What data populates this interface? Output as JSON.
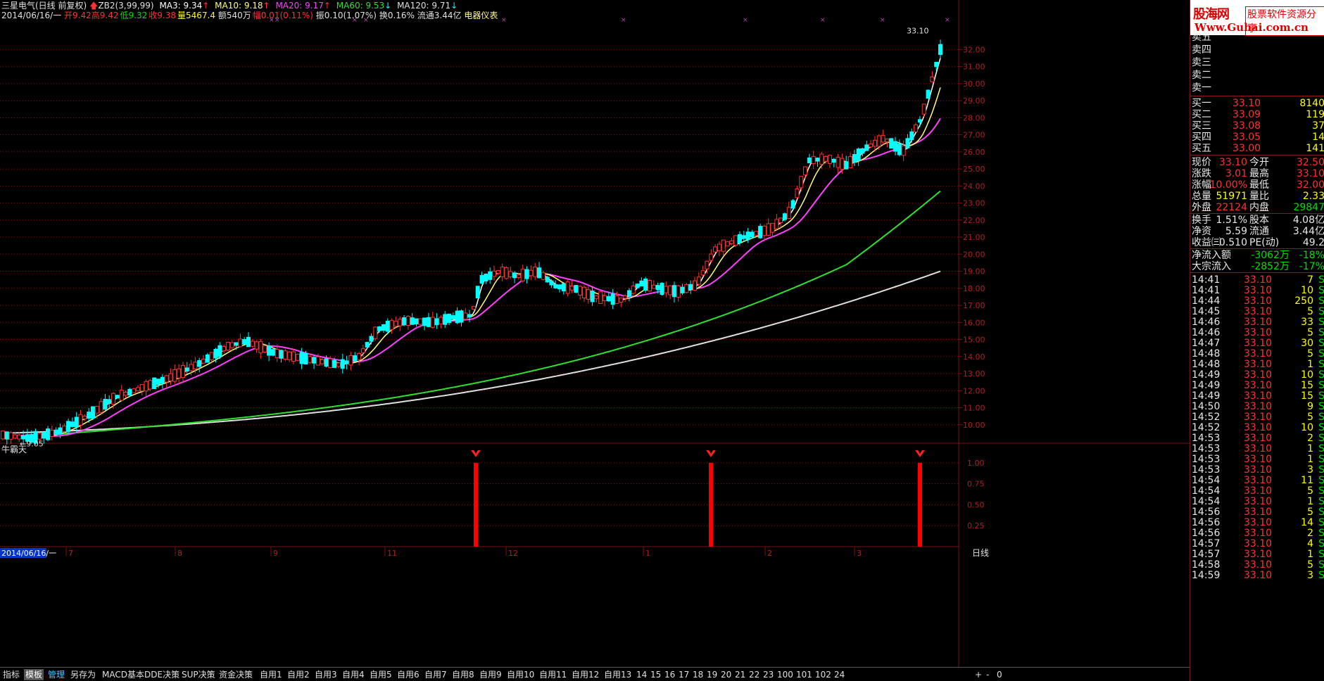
{
  "header": {
    "stock_name": "三星电气(日线 前复权)",
    "indicator": "ZB2(3,99,99)",
    "ma3": "MA3: 9.34",
    "ma10": "MA10: 9.18",
    "ma20": "MA20: 9.17",
    "ma60": "MA60: 9.53",
    "ma120": "MA120: 9.71",
    "date": "2014/06/16/一",
    "open": "开9.42",
    "high": "高9.42",
    "low": "低9.32",
    "close": "收9.38",
    "volume": "量5467.4",
    "amount": "额540万",
    "change": "幅0.01(0.11%)",
    "amplitude": "振0.10(1.07%)",
    "turnover": "换0.16%",
    "float": "流通3.44亿",
    "industry": "电器仪表"
  },
  "colors": {
    "up": "#ff3232",
    "down": "#00ffff",
    "ma3": "#ffffff",
    "ma10": "#ffff80",
    "ma20": "#ff40ff",
    "ma60": "#30e030",
    "ma120": "#e0e0e0",
    "grid": "#7a1010",
    "panel_border": "#8a1a1a"
  },
  "main_chart": {
    "y_ticks": [
      "10.00",
      "11.00",
      "12.00",
      "13.00",
      "14.00",
      "15.00",
      "16.00",
      "17.00",
      "18.00",
      "19.00",
      "20.00",
      "21.00",
      "22.00",
      "23.00",
      "24.00",
      "25.00",
      "26.00",
      "27.00",
      "28.00",
      "29.00",
      "30.00",
      "31.00",
      "32.00"
    ],
    "y_min": 9.0,
    "y_max": 33.5,
    "low_marker": "9.05",
    "high_marker": "33.10"
  },
  "sub_chart": {
    "title": "牛霸天",
    "y_ticks": [
      "1.00",
      "0.75",
      "0.50",
      "0.25"
    ],
    "signal_x": [
      676,
      1010,
      1307
    ],
    "signal_value": 1.0
  },
  "x_axis": {
    "date_label": "2014/06/16/一",
    "month_labels": [
      {
        "label": "7",
        "x": 97
      },
      {
        "label": "8",
        "x": 252
      },
      {
        "label": "9",
        "x": 388
      },
      {
        "label": "11",
        "x": 550
      },
      {
        "label": "12",
        "x": 722
      },
      {
        "label": "1",
        "x": 917
      },
      {
        "label": "2",
        "x": 1090
      },
      {
        "label": "3",
        "x": 1217
      }
    ],
    "period": "日线"
  },
  "bottom_tabs": [
    "指标",
    "模板",
    "管理",
    "另存为",
    "MACD基本",
    "DDE决策",
    "SUP决策",
    "资金决策",
    "自用1",
    "自用2",
    "自用3",
    "自用4",
    "自用5",
    "自用6",
    "自用7",
    "自用8",
    "自用9",
    "自用10",
    "自用11",
    "自用12",
    "自用13",
    "14",
    "15",
    "16",
    "17",
    "18",
    "19",
    "20",
    "21",
    "22",
    "23",
    "100",
    "101",
    "102",
    "24"
  ],
  "bottom_controls": [
    "+",
    "-",
    "0"
  ],
  "logo": {
    "name": "股海网",
    "slogan": "股票软件资源分享",
    "url": "Www.Guhai.com.cn"
  },
  "order_book": {
    "sells": [
      {
        "label": "卖五"
      },
      {
        "label": "卖四"
      },
      {
        "label": "卖三"
      },
      {
        "label": "卖二"
      },
      {
        "label": "卖一"
      }
    ],
    "buys": [
      {
        "label": "买一",
        "price": "33.10",
        "vol": "8140"
      },
      {
        "label": "买二",
        "price": "33.09",
        "vol": "119"
      },
      {
        "label": "买三",
        "price": "33.08",
        "vol": "37"
      },
      {
        "label": "买四",
        "price": "33.05",
        "vol": "14"
      },
      {
        "label": "买五",
        "price": "33.00",
        "vol": "141"
      }
    ]
  },
  "quote": [
    {
      "l1": "现价",
      "v1": "33.10",
      "c1": "red",
      "l2": "今开",
      "v2": "32.50",
      "c2": "red"
    },
    {
      "l1": "涨跌",
      "v1": "3.01",
      "c1": "red",
      "l2": "最高",
      "v2": "33.10",
      "c2": "red"
    },
    {
      "l1": "涨幅",
      "v1": "10.00%",
      "c1": "red",
      "l2": "最低",
      "v2": "32.00",
      "c2": "red"
    },
    {
      "l1": "总量",
      "v1": "51971",
      "c1": "yel",
      "l2": "量比",
      "v2": "2.33",
      "c2": "yel"
    },
    {
      "l1": "外盘",
      "v1": "22124",
      "c1": "red",
      "l2": "内盘",
      "v2": "29847",
      "c2": "green"
    },
    {
      "l1": "换手",
      "v1": "1.51%",
      "c1": "wht",
      "l2": "股本",
      "v2": "4.08亿",
      "c2": "wht"
    },
    {
      "l1": "净资",
      "v1": "5.59",
      "c1": "wht",
      "l2": "流通",
      "v2": "3.44亿",
      "c2": "wht"
    },
    {
      "l1": "收益㈢",
      "v1": "0.510",
      "c1": "wht",
      "l2": "PE(动)",
      "v2": "49.2",
      "c2": "wht"
    }
  ],
  "flows": [
    {
      "label": "净流入额",
      "value": "-3062万",
      "pct": "-18%"
    },
    {
      "label": "大宗流入",
      "value": "-2852万",
      "pct": "-17%"
    }
  ],
  "ticks": [
    {
      "time": "14:41",
      "price": "33.10",
      "vol": "7",
      "side": "S"
    },
    {
      "time": "14:41",
      "price": "33.10",
      "vol": "10",
      "side": "S"
    },
    {
      "time": "14:44",
      "price": "33.10",
      "vol": "250",
      "side": "S"
    },
    {
      "time": "14:45",
      "price": "33.10",
      "vol": "5",
      "side": "S"
    },
    {
      "time": "14:46",
      "price": "33.10",
      "vol": "33",
      "side": "S"
    },
    {
      "time": "14:46",
      "price": "33.10",
      "vol": "5",
      "side": "S"
    },
    {
      "time": "14:47",
      "price": "33.10",
      "vol": "30",
      "side": "S"
    },
    {
      "time": "14:48",
      "price": "33.10",
      "vol": "5",
      "side": "S"
    },
    {
      "time": "14:48",
      "price": "33.10",
      "vol": "1",
      "side": "S"
    },
    {
      "time": "14:49",
      "price": "33.10",
      "vol": "10",
      "side": "S"
    },
    {
      "time": "14:49",
      "price": "33.10",
      "vol": "15",
      "side": "S"
    },
    {
      "time": "14:49",
      "price": "33.10",
      "vol": "15",
      "side": "S"
    },
    {
      "time": "14:50",
      "price": "33.10",
      "vol": "9",
      "side": "S"
    },
    {
      "time": "14:52",
      "price": "33.10",
      "vol": "5",
      "side": "S"
    },
    {
      "time": "14:52",
      "price": "33.10",
      "vol": "10",
      "side": "S"
    },
    {
      "time": "14:53",
      "price": "33.10",
      "vol": "2",
      "side": "S"
    },
    {
      "time": "14:53",
      "price": "33.10",
      "vol": "1",
      "side": "S"
    },
    {
      "time": "14:53",
      "price": "33.10",
      "vol": "1",
      "side": "S"
    },
    {
      "time": "14:53",
      "price": "33.10",
      "vol": "3",
      "side": "S"
    },
    {
      "time": "14:54",
      "price": "33.10",
      "vol": "11",
      "side": "S"
    },
    {
      "time": "14:54",
      "price": "33.10",
      "vol": "5",
      "side": "S"
    },
    {
      "time": "14:54",
      "price": "33.10",
      "vol": "1",
      "side": "S"
    },
    {
      "time": "14:56",
      "price": "33.10",
      "vol": "5",
      "side": "S"
    },
    {
      "time": "14:56",
      "price": "33.10",
      "vol": "14",
      "side": "S"
    },
    {
      "time": "14:56",
      "price": "33.10",
      "vol": "2",
      "side": "S"
    },
    {
      "time": "14:57",
      "price": "33.10",
      "vol": "4",
      "side": "S"
    },
    {
      "time": "14:57",
      "price": "33.10",
      "vol": "1",
      "side": "S"
    },
    {
      "time": "14:58",
      "price": "33.10",
      "vol": "5",
      "side": "S"
    },
    {
      "time": "14:59",
      "price": "33.10",
      "vol": "3",
      "side": "S"
    }
  ]
}
